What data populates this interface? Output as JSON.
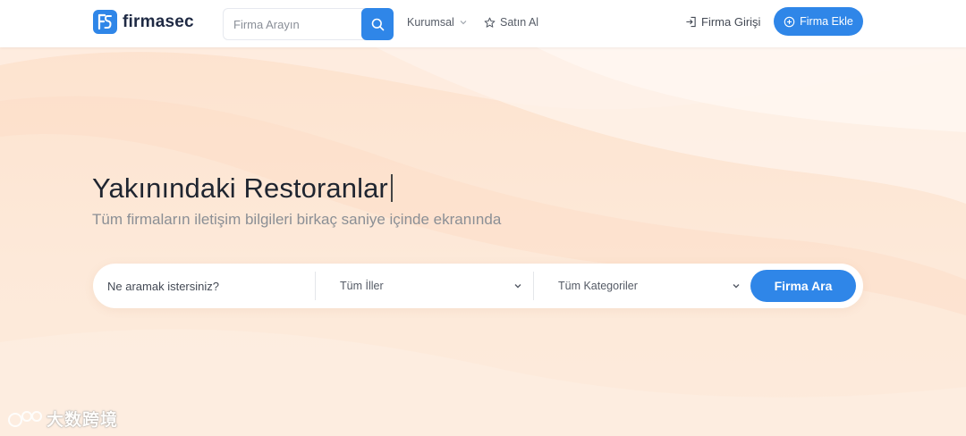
{
  "brand": {
    "name": "firmasec",
    "color": "#2f86e8"
  },
  "header": {
    "search_placeholder": "Firma Arayın",
    "nav": {
      "kurumsal": "Kurumsal",
      "satin_al": "Satın Al"
    },
    "login": "Firma Girişi",
    "add_company": "Firma Ekle"
  },
  "hero": {
    "title": "Yakınındaki Restoranlar",
    "subtitle": "Tüm firmaların iletişim bilgileri birkaç saniye içinde ekranında",
    "search": {
      "placeholder": "Ne aramak istersiniz?",
      "city_select": "Tüm İller",
      "category_select": "Tüm Kategoriler",
      "button": "Firma Ara"
    }
  },
  "watermark": {
    "text": "大数跨境"
  },
  "icons": {
    "logo": "firmasec-logo-icon",
    "search": "search-icon",
    "chevron": "chevron-down-icon",
    "star": "star-icon",
    "login": "login-icon",
    "add": "plus-circle-icon"
  },
  "colors": {
    "accent": "#2f86e8",
    "hero_bg": "#fde8d7",
    "title": "#1f2530",
    "subtitle": "#8b8f95"
  }
}
